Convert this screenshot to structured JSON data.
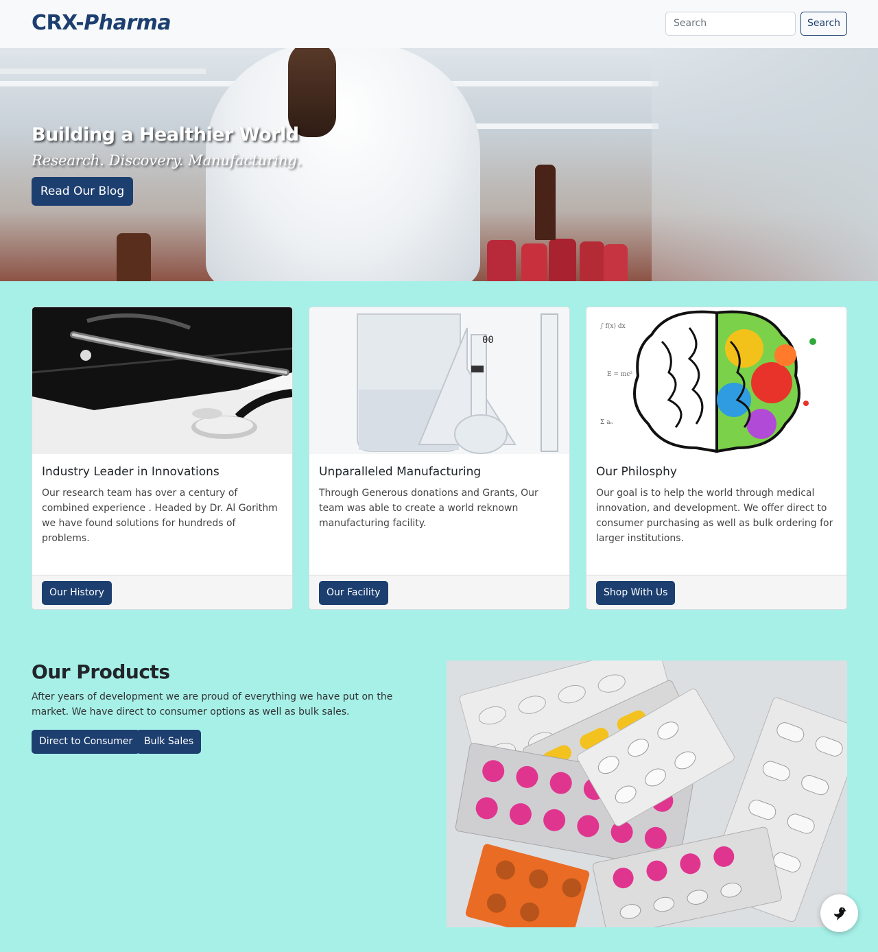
{
  "header": {
    "brand_part1": "CRX-",
    "brand_part2": "Pharma",
    "search_placeholder": "Search",
    "search_button": "Search"
  },
  "hero": {
    "title": "Building a Healthier World",
    "subtitle": "Research. Discovery. Manufacturing.",
    "button": "Read Our Blog"
  },
  "cards": [
    {
      "title": "Industry Leader in Innovations",
      "text": "Our research team has over a century of combined experience . Headed by Dr. Al Gorithm we have found solutions for hundreds of problems.",
      "button": "Our History",
      "image": "stethoscope"
    },
    {
      "title": "Unparalleled Manufacturing",
      "text": "Through Generous donations and Grants, Our team was able to create a world reknown manufacturing facility.",
      "button": "Our Facility",
      "image": "lab-glassware"
    },
    {
      "title": "Our Philosphy",
      "text": "Our goal is to help the world through medical innovation, and development. We offer direct to consumer purchasing as well as bulk ordering for larger institutions.",
      "button": "Shop With Us",
      "image": "brain-illustration"
    }
  ],
  "products": {
    "title": "Our Products",
    "text": "After years of development we are proud of everything we have put on the market. We have direct to consumer options as well as bulk sales.",
    "buttons": [
      "Direct to Consumer",
      "Bulk Sales"
    ],
    "image": "pill-blister-packs"
  },
  "colors": {
    "brand": "#1d3f70",
    "page_background": "#a6f0e8",
    "navbar_background": "#f8f9fa"
  },
  "icons": {
    "fab": "bird-icon"
  }
}
